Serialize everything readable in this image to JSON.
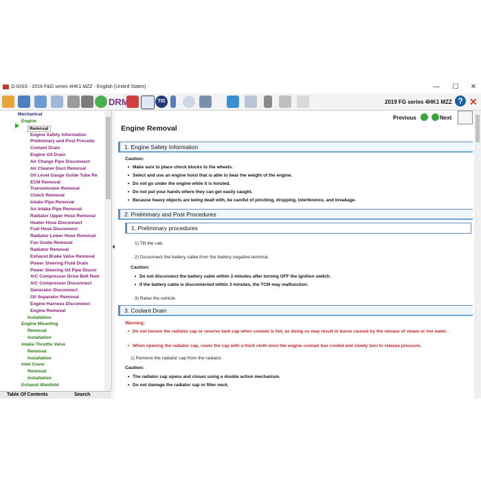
{
  "window": {
    "title": "G-IDSS - 2019 F&G series 4HK1 MZZ - English (United States)",
    "controls": {
      "minimize": "—",
      "maximize": "☐",
      "close": "✕"
    }
  },
  "toolbar": {
    "drm": "DRM",
    "tis": "TIS",
    "series": "2019 FG series 4HK1 MZZ",
    "help": "?"
  },
  "sidebar": {
    "items": [
      {
        "label": "Mechanical",
        "level": 0,
        "color": "blue"
      },
      {
        "label": "Engine",
        "level": 1,
        "color": "green"
      },
      {
        "label": "Removal",
        "level": 2,
        "color": "current"
      },
      {
        "label": "Engine Safety Information",
        "level": 3,
        "color": "pink"
      },
      {
        "label": "Preliminary and Post Procedu",
        "level": 3,
        "color": "pink"
      },
      {
        "label": "Coolant Drain",
        "level": 3,
        "color": "pink"
      },
      {
        "label": "Engine Oil Drain",
        "level": 3,
        "color": "pink"
      },
      {
        "label": "Air Charge Pipe Disconnect",
        "level": 3,
        "color": "pink"
      },
      {
        "label": "Air Cleaner Duct Removal",
        "level": 3,
        "color": "pink"
      },
      {
        "label": "Oil Level Gauge Guide Tube Re",
        "level": 3,
        "color": "pink"
      },
      {
        "label": "ECM Removal",
        "level": 3,
        "color": "pink"
      },
      {
        "label": "Transmission Removal",
        "level": 3,
        "color": "pink"
      },
      {
        "label": "Clutch Removal",
        "level": 3,
        "color": "pink"
      },
      {
        "label": "Intake Pipe Removal",
        "level": 3,
        "color": "pink"
      },
      {
        "label": "Air Intake Pipe Removal",
        "level": 3,
        "color": "pink"
      },
      {
        "label": "Radiator Upper Hose Removal",
        "level": 3,
        "color": "pink"
      },
      {
        "label": "Heater Hose Disconnect",
        "level": 3,
        "color": "pink"
      },
      {
        "label": "Fuel Hose Disconnect",
        "level": 3,
        "color": "pink"
      },
      {
        "label": "Radiator Lower Hose Removal",
        "level": 3,
        "color": "pink"
      },
      {
        "label": "Fan Guide Removal",
        "level": 3,
        "color": "pink"
      },
      {
        "label": "Radiator Removal",
        "level": 3,
        "color": "pink"
      },
      {
        "label": "Exhaust Brake Valve Removal",
        "level": 3,
        "color": "pink"
      },
      {
        "label": "Power Steering Fluid Drain",
        "level": 3,
        "color": "pink"
      },
      {
        "label": "Power Steering Oil Pipe Discor",
        "level": 3,
        "color": "pink"
      },
      {
        "label": "A/C Compressor Drive Belt Rem",
        "level": 3,
        "color": "pink"
      },
      {
        "label": "A/C Compressor Disconnect",
        "level": 3,
        "color": "pink"
      },
      {
        "label": "Generator Disconnect",
        "level": 3,
        "color": "pink"
      },
      {
        "label": "Oil Separator Removal",
        "level": 3,
        "color": "pink"
      },
      {
        "label": "Engine Harness Disconnect",
        "level": 3,
        "color": "pink"
      },
      {
        "label": "Engine Removal",
        "level": 3,
        "color": "pink"
      },
      {
        "label": "Installation",
        "level": 2,
        "color": "green"
      },
      {
        "label": "Engine Mounting",
        "level": 1,
        "color": "green"
      },
      {
        "label": "Removal",
        "level": 2,
        "color": "green"
      },
      {
        "label": "Installation",
        "level": 2,
        "color": "green"
      },
      {
        "label": "Intake Throttle Valve",
        "level": 1,
        "color": "green"
      },
      {
        "label": "Removal",
        "level": 2,
        "color": "green"
      },
      {
        "label": "Installation",
        "level": 2,
        "color": "green"
      },
      {
        "label": "Inlet Cover",
        "level": 1,
        "color": "green"
      },
      {
        "label": "Removal",
        "level": 2,
        "color": "green"
      },
      {
        "label": "Installation",
        "level": 2,
        "color": "green"
      },
      {
        "label": "Exhaust Manifold",
        "level": 1,
        "color": "green"
      }
    ],
    "tabs": [
      "Table Of Contents",
      "Search"
    ]
  },
  "content": {
    "nav": {
      "previous": "Previous",
      "next": "Next"
    },
    "page_title": "Engine Removal",
    "sec1": {
      "heading": "1. Engine Safety Information",
      "caution_label": "Caution:",
      "bullets": [
        "Make sure to place chock blocks to the wheels.",
        "Select and use an engine hoist that is able to bear the weight of the engine.",
        "Do not go under the engine while it is hoisted.",
        "Do not put your hands where they can get easily caught.",
        "Because heavy objects are being dealt with, be careful of pinching, dropping, interference, and breakage."
      ]
    },
    "sec2": {
      "heading": "2. Preliminary and Post Procedures",
      "sub_heading": "1. Preliminary procedures",
      "step1": "1) Tilt the cab.",
      "step2": "2) Disconnect the battery cable from the battery negative terminal.",
      "caution_label": "Caution:",
      "bullets": [
        "Do not disconnect the battery cable within 3 minutes after turning OFF the ignition switch.",
        "If the battery cable is disconnected within 3 minutes, the TCM may malfunction."
      ],
      "step3": "3) Raise the vehicle."
    },
    "sec3": {
      "heading": "3. Coolant Drain",
      "warning_label": "Warning:",
      "warnings": [
        "Do not loosen the radiator cap or reserve tank cap when coolant is hot, as doing so may result in burns caused by the release of steam or hot water.",
        "When opening the radiator cap, cover the cap with a thick cloth once the engine coolant has cooled and slowly turn to release pressure."
      ],
      "step1": "1) Remove the radiator cap from the radiator.",
      "caution_label": "Caution:",
      "bullets": [
        "The radiator cap opens and closes using a double action mechanism.",
        "Do not damage the radiator cap or filler neck."
      ]
    }
  }
}
